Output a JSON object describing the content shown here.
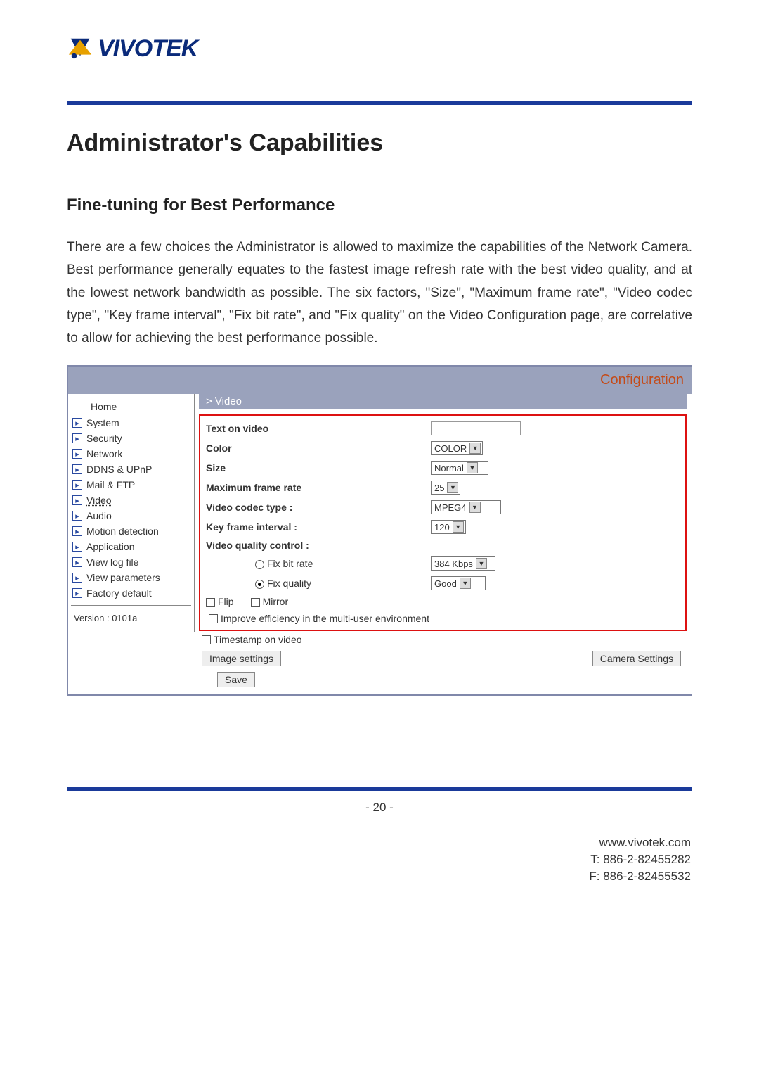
{
  "logo": {
    "text": "VIVOTEK"
  },
  "heading": "Administrator's Capabilities",
  "subheading": "Fine-tuning for Best Performance",
  "paragraph": "There are a few choices the Administrator is allowed to maximize the capabilities of the Network Camera. Best performance generally equates to the fastest image refresh rate with the best video quality, and at the lowest network bandwidth as possible. The six factors, \"Size\", \"Maximum frame rate\", \"Video codec type\", \"Key frame interval\", \"Fix bit rate\", and \"Fix quality\" on the Video Configuration page, are correlative to allow for achieving the best performance possible.",
  "embed": {
    "title": "Configuration",
    "breadcrumb": "> Video",
    "sidebar": {
      "home": "Home",
      "items": [
        {
          "label": "System"
        },
        {
          "label": "Security"
        },
        {
          "label": "Network"
        },
        {
          "label": "DDNS & UPnP"
        },
        {
          "label": "Mail & FTP"
        },
        {
          "label": "Video",
          "current": true
        },
        {
          "label": "Audio"
        },
        {
          "label": "Motion detection"
        },
        {
          "label": "Application"
        },
        {
          "label": "View log file"
        },
        {
          "label": "View parameters"
        },
        {
          "label": "Factory default"
        }
      ],
      "version": "Version : 0101a"
    },
    "form": {
      "text_on_video_label": "Text on video",
      "color_label": "Color",
      "color_value": "COLOR",
      "size_label": "Size",
      "size_value": "Normal",
      "max_frame_label": "Maximum frame rate",
      "max_frame_value": "25",
      "codec_label": "Video codec type :",
      "codec_value": "MPEG4",
      "keyframe_label": "Key frame interval :",
      "keyframe_value": "120",
      "quality_label": "Video quality control :",
      "fix_bitrate_label": "Fix bit rate",
      "fix_bitrate_value": "384 Kbps",
      "fix_quality_label": "Fix quality",
      "fix_quality_value": "Good",
      "flip_label": "Flip",
      "mirror_label": "Mirror",
      "improve_label": "Improve efficiency in the multi-user environment",
      "timestamp_label": "Timestamp on video",
      "image_settings_btn": "Image settings",
      "camera_settings_btn": "Camera  Settings",
      "save_btn": "Save"
    }
  },
  "page_number": "- 20 -",
  "footer": {
    "url": "www.vivotek.com",
    "tel": "T: 886-2-82455282",
    "fax": "F: 886-2-82455532"
  }
}
